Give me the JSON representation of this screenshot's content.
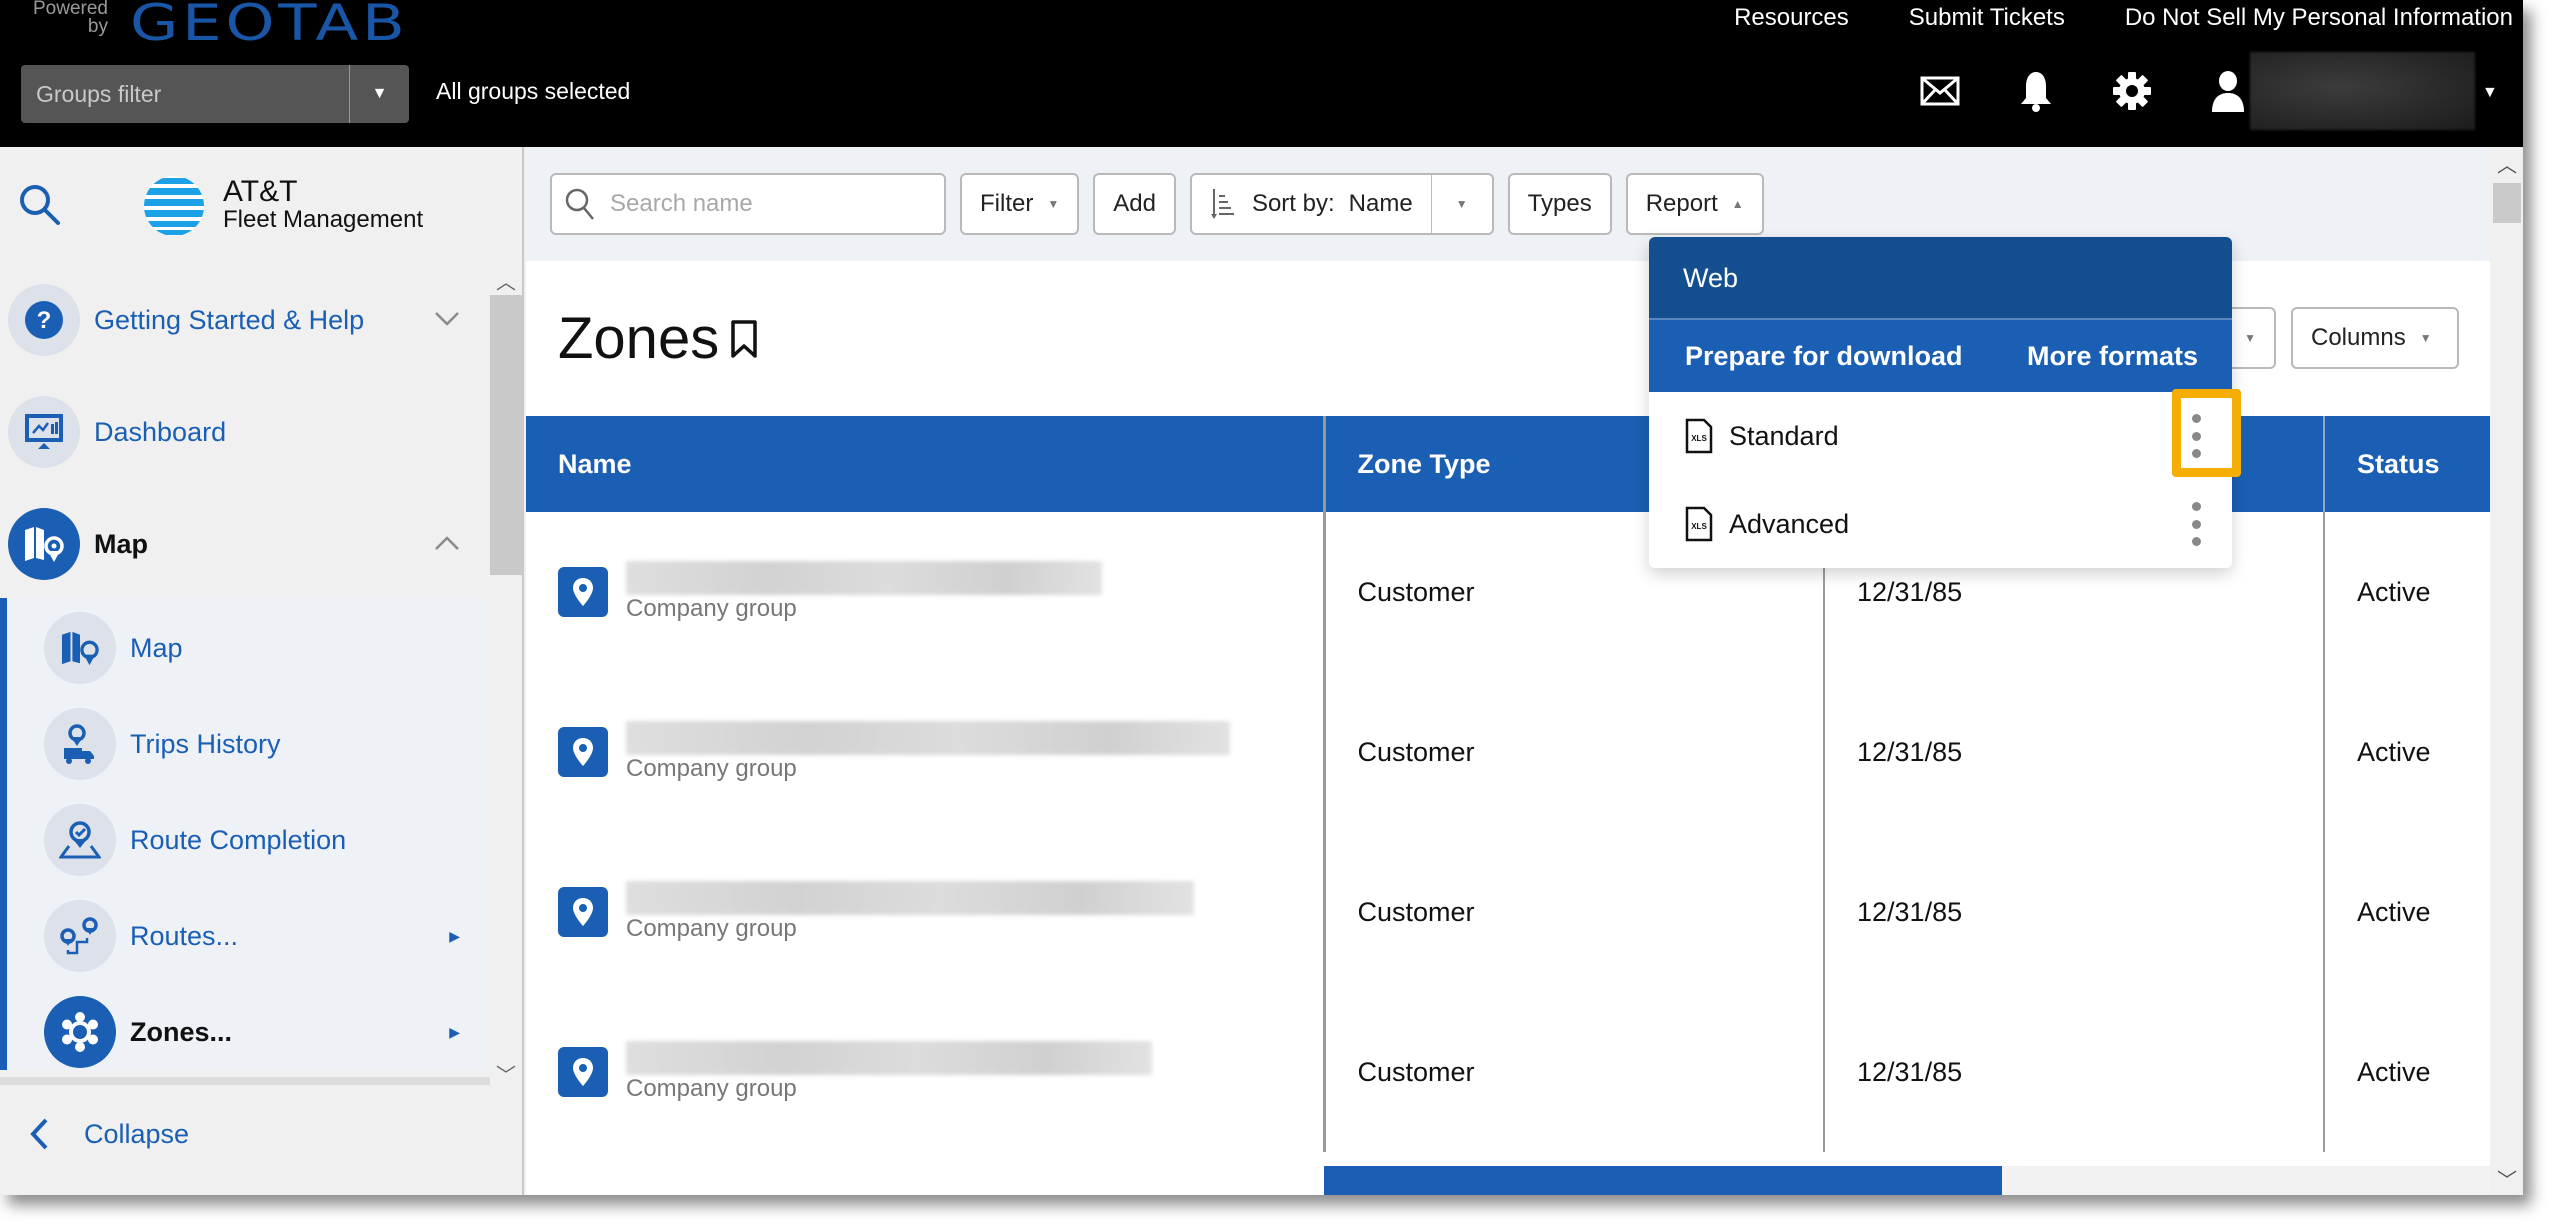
{
  "topbar": {
    "powered_by": "Powered by",
    "brand": "GEOTAB",
    "links": [
      "Resources",
      "Submit Tickets",
      "Do Not Sell My Personal Information"
    ],
    "groups_filter_placeholder": "Groups filter",
    "groups_status": "All groups selected",
    "icons": [
      "mail-icon",
      "bell-icon",
      "gear-icon",
      "user-icon"
    ]
  },
  "sidebar": {
    "logo_line1": "AT&T",
    "logo_line2": "Fleet Management",
    "items": [
      {
        "label": "Getting Started & Help",
        "icon": "help-icon",
        "expander": "chevron-down"
      },
      {
        "label": "Dashboard",
        "icon": "dashboard-icon"
      },
      {
        "label": "Map",
        "icon": "map-icon",
        "expander": "chevron-up",
        "active": true
      }
    ],
    "subitems": [
      {
        "label": "Map",
        "icon": "map-icon"
      },
      {
        "label": "Trips History",
        "icon": "trips-history-icon"
      },
      {
        "label": "Route Completion",
        "icon": "route-completion-icon"
      },
      {
        "label": "Routes...",
        "icon": "routes-icon",
        "has_submenu": true
      },
      {
        "label": "Zones...",
        "icon": "zones-icon",
        "has_submenu": true,
        "active": true
      }
    ],
    "collapse_label": "Collapse"
  },
  "toolbar": {
    "search_placeholder": "Search name",
    "filter_label": "Filter",
    "add_label": "Add",
    "sort_prefix": "Sort by:",
    "sort_value": "Name",
    "types_label": "Types",
    "report_label": "Report"
  },
  "page": {
    "title": "Zones",
    "columns_label": "Columns"
  },
  "report_menu": {
    "section": "Web",
    "prepare": "Prepare for download",
    "more_formats": "More formats",
    "items": [
      {
        "label": "Standard",
        "file_type": "XLS",
        "highlighted": true
      },
      {
        "label": "Advanced",
        "file_type": "XLS"
      }
    ]
  },
  "table": {
    "headers": [
      "Name",
      "Zone Type",
      "",
      "Status"
    ],
    "rows": [
      {
        "group": "Company group",
        "zone_type": "Customer",
        "date": "12/31/85",
        "status": "Active"
      },
      {
        "group": "Company group",
        "zone_type": "Customer",
        "date": "12/31/85",
        "status": "Active"
      },
      {
        "group": "Company group",
        "zone_type": "Customer",
        "date": "12/31/85",
        "status": "Active"
      },
      {
        "group": "Company group",
        "zone_type": "Customer",
        "date": "12/31/85",
        "status": "Active"
      }
    ]
  },
  "colors": {
    "brand_blue": "#1a5fb4",
    "menu_dark_blue": "#134e8e",
    "highlight_orange": "#f6ad04",
    "topbar_bg": "#000000"
  }
}
